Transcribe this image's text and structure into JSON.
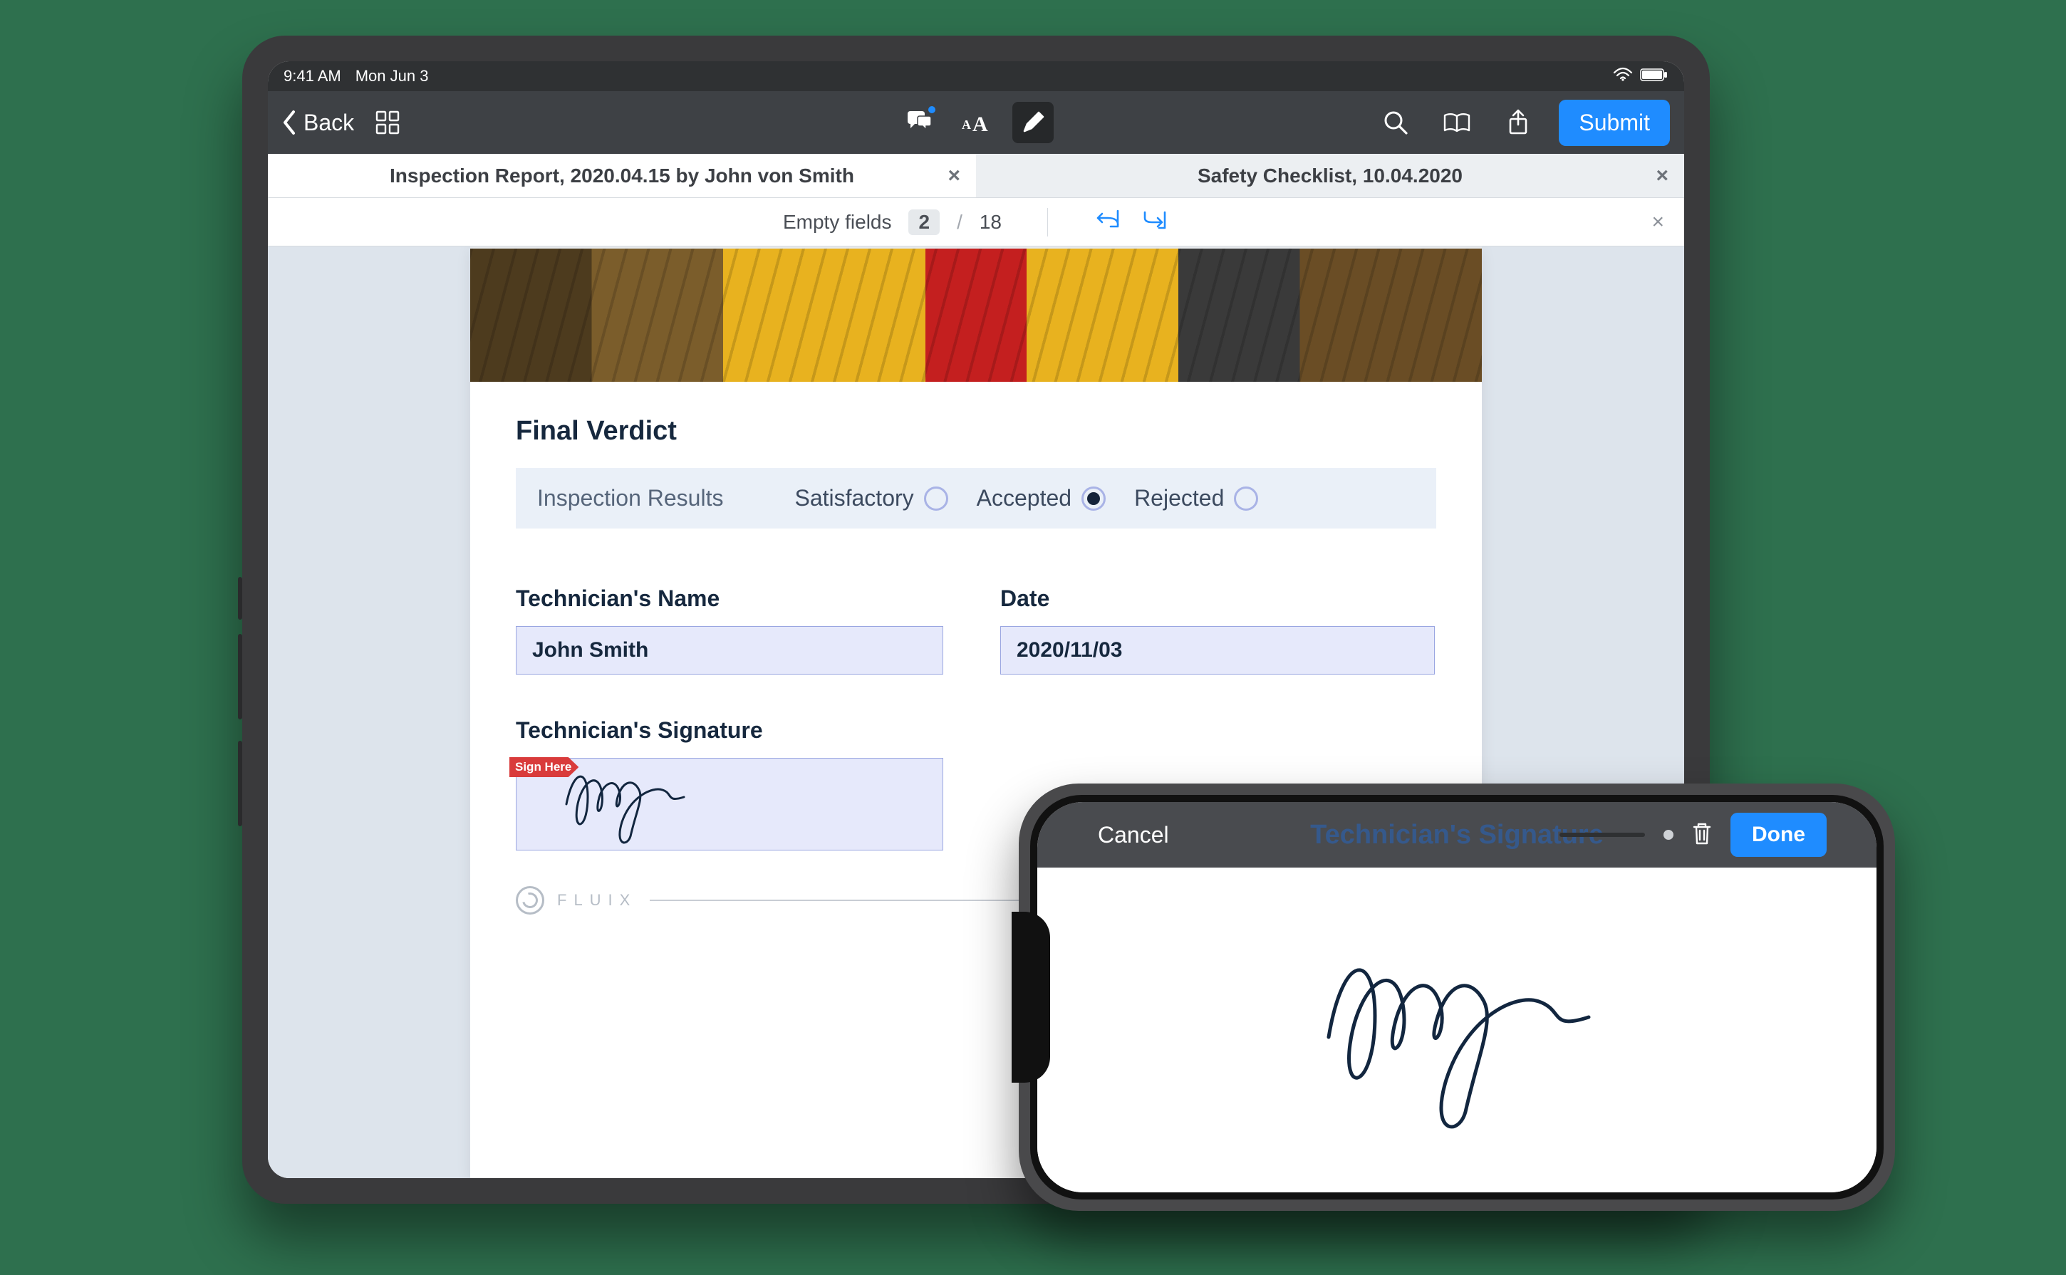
{
  "ipad": {
    "status": {
      "time": "9:41 AM",
      "date": "Mon Jun 3"
    },
    "nav": {
      "back_label": "Back",
      "submit_label": "Submit"
    },
    "tabs": [
      {
        "label": "Inspection Report, 2020.04.15 by John von Smith",
        "active": true
      },
      {
        "label": "Safety Checklist, 10.04.2020",
        "active": false
      }
    ],
    "fields_bar": {
      "label": "Empty fields",
      "empty": "2",
      "total": "18"
    },
    "doc": {
      "final_verdict_title": "Final Verdict",
      "results_label": "Inspection Results",
      "options": {
        "satisfactory": "Satisfactory",
        "accepted": "Accepted",
        "rejected": "Rejected"
      },
      "selected": "accepted",
      "tech_name_label": "Technician's Name",
      "tech_name_value": "John Smith",
      "date_label": "Date",
      "date_value": "2020/11/03",
      "signature_label": "Technician's Signature",
      "sign_here": "Sign Here",
      "brand": "FLUIX"
    }
  },
  "iphone": {
    "cancel_label": "Cancel",
    "title_ghost": "Technician's Signature",
    "done_label": "Done"
  }
}
